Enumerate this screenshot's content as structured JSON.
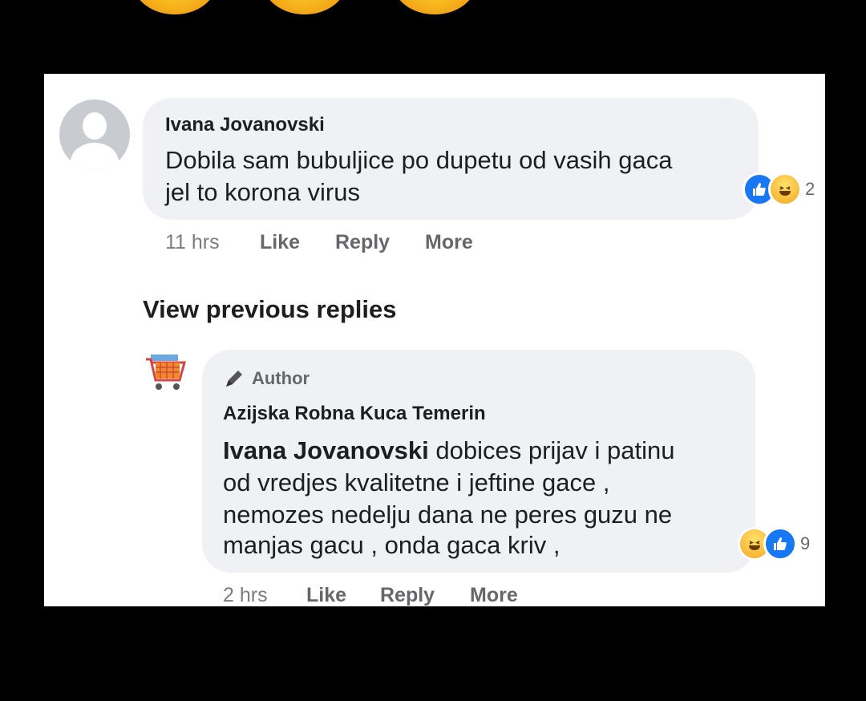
{
  "comment": {
    "author": "Ivana Jovanovski",
    "text": "Dobila sam bubuljice po dupetu od vasih gaca\njel to korona virus",
    "line1": "Dobila sam bubuljice po dupetu od vasih gaca",
    "line2": "jel to korona virus",
    "time": "11 hrs",
    "like_label": "Like",
    "reply_label": "Reply",
    "more_label": "More",
    "reactions": [
      "like",
      "haha"
    ],
    "reaction_count": "2"
  },
  "view_previous_replies": "View previous replies",
  "reply": {
    "badge": "Author",
    "author": "Azijska Robna Kuca Temerin",
    "mention": "Ivana Jovanovski",
    "line1_rest": " dobices prijav i patinu",
    "line2": "od vredjes kvalitetne i jeftine gace ,",
    "line3": "nemozes nedelju dana ne peres guzu ne",
    "line4": "manjas gacu , onda gaca kriv  ,",
    "time": "2 hrs",
    "like_label": "Like",
    "reply_label": "Reply",
    "more_label": "More",
    "reactions": [
      "haha",
      "like"
    ],
    "reaction_count": "9"
  },
  "colors": {
    "like_blue": "#1877f2",
    "bubble_bg": "#eff1f5",
    "meta_gray": "#65676b"
  }
}
